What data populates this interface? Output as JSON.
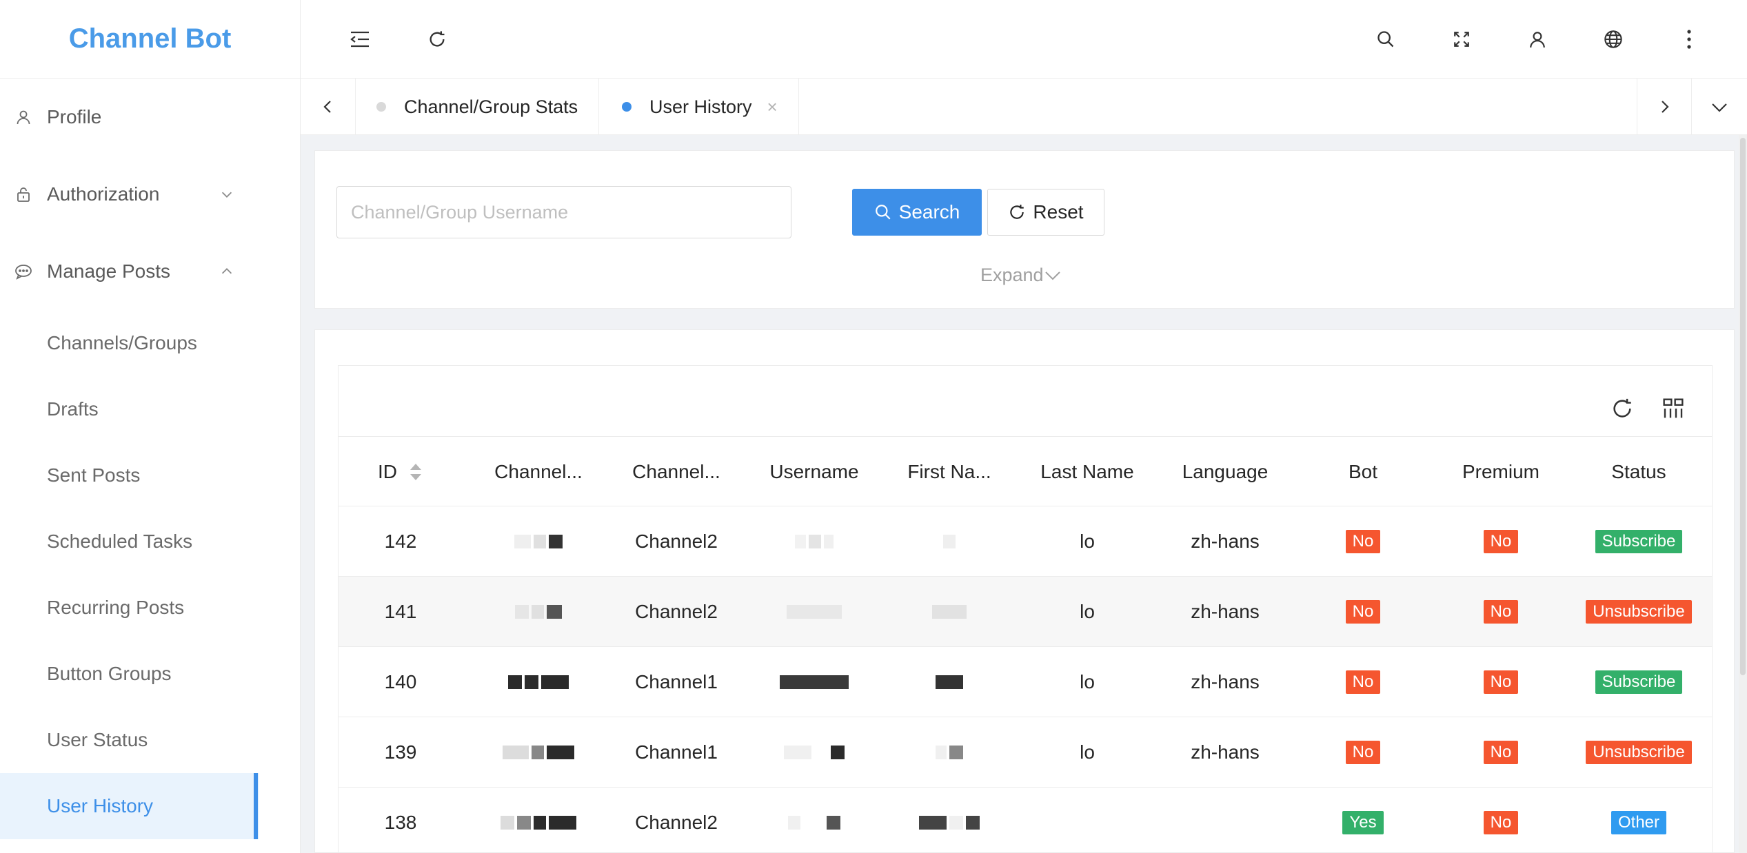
{
  "app": {
    "brand": "Channel Bot"
  },
  "sidebar": {
    "top_items": [
      {
        "label": "Profile",
        "icon": "user-icon"
      },
      {
        "label": "Authorization",
        "icon": "lock-icon"
      },
      {
        "label": "Manage Posts",
        "icon": "chat-icon"
      }
    ],
    "sub_items": [
      {
        "label": "Channels/Groups"
      },
      {
        "label": "Drafts"
      },
      {
        "label": "Sent Posts"
      },
      {
        "label": "Scheduled Tasks"
      },
      {
        "label": "Recurring Posts"
      },
      {
        "label": "Button Groups"
      },
      {
        "label": "User Status"
      },
      {
        "label": "User History",
        "active": true
      }
    ]
  },
  "tabs": [
    {
      "label": "Channel/Group Stats",
      "active": false
    },
    {
      "label": "User History",
      "active": true,
      "close": "×"
    }
  ],
  "search": {
    "placeholder": "Channel/Group Username",
    "search_label": "Search",
    "reset_label": "Reset",
    "expand_label": "Expand"
  },
  "table": {
    "columns": [
      "ID",
      "Channel...",
      "Channel...",
      "Username",
      "First Na...",
      "Last Name",
      "Language",
      "Bot",
      "Premium",
      "Status"
    ],
    "rows": [
      {
        "id": "142",
        "channel": "Channel2",
        "last_name": "lo",
        "language": "zh-hans",
        "bot": "No",
        "premium": "No",
        "status": "Subscribe"
      },
      {
        "id": "141",
        "channel": "Channel2",
        "last_name": "lo",
        "language": "zh-hans",
        "bot": "No",
        "premium": "No",
        "status": "Unsubscribe"
      },
      {
        "id": "140",
        "channel": "Channel1",
        "last_name": "lo",
        "language": "zh-hans",
        "bot": "No",
        "premium": "No",
        "status": "Subscribe"
      },
      {
        "id": "139",
        "channel": "Channel1",
        "last_name": "lo",
        "language": "zh-hans",
        "bot": "No",
        "premium": "No",
        "status": "Unsubscribe"
      },
      {
        "id": "138",
        "channel": "Channel2",
        "last_name": "",
        "language": "",
        "bot": "Yes",
        "premium": "No",
        "status": "Other"
      }
    ]
  },
  "colors": {
    "accent": "#3d8fe8",
    "brand": "#4a9be8",
    "tag_red": "#f5562f",
    "tag_green": "#33b06a",
    "tag_blue": "#2f9bf0"
  }
}
